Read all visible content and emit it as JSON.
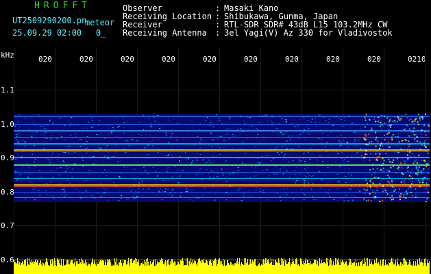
{
  "header": {
    "station_name": "HROFFT",
    "filename": "UT2509290200.pn",
    "mode": "meteor",
    "datetime": "25.09.29 02:00",
    "counter": "0_",
    "fields": [
      {
        "label": "Observer",
        "value": "Masaki Kano"
      },
      {
        "label": "Receiving Location",
        "value": "Shibukawa, Gunma, Japan"
      },
      {
        "label": "Receiver",
        "value": "RTL-SDR SDR# 43dB L15 103.2MHz CW"
      },
      {
        "label": "Receiving Antenna",
        "value": "3el Yagi(V) Az 330 for Vladivostok"
      }
    ],
    "separator": ":"
  },
  "axes": {
    "y_unit": "kHz",
    "y_ticks": [
      "1.1",
      "1.0",
      "0.9",
      "0.8",
      "0.7",
      "0.6"
    ],
    "x_ticks": [
      "020",
      "020",
      "020",
      "020",
      "020",
      "020",
      "020",
      "020",
      "020",
      "0210"
    ]
  },
  "colors": {
    "background": "#000000",
    "band": "#050a78",
    "cyan_text": "#5ff0ff",
    "yellow_text": "#ffff3c",
    "title_green": "#22dd22",
    "signal_level": "#ffff00"
  }
}
